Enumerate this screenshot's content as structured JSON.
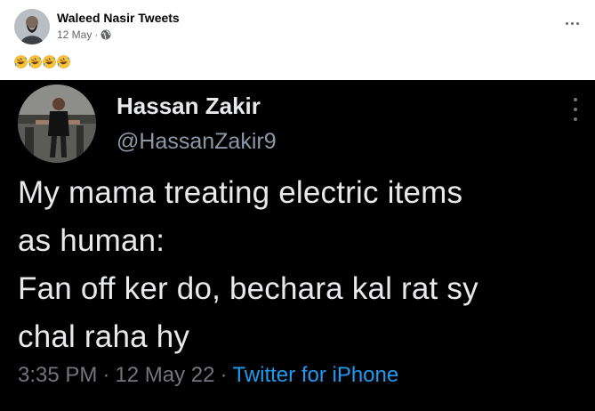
{
  "facebook_post": {
    "author": "Waleed Nasir Tweets",
    "date": "12 May",
    "meta_separator": "·",
    "audience_icon": "globe-icon",
    "more_icon": "more-horizontal-icon",
    "caption_emojis": [
      "rolling-on-floor-laughing-emoji",
      "rolling-on-floor-laughing-emoji",
      "rolling-on-floor-laughing-emoji",
      "rolling-on-floor-laughing-emoji"
    ]
  },
  "tweet": {
    "display_name": "Hassan Zakir",
    "handle": "@HassanZakir9",
    "more_icon": "more-vertical-icon",
    "text_lines": [
      "My mama treating electric items",
      "as human:",
      "Fan off ker do, bechara kal rat sy",
      "chal raha hy"
    ],
    "time": "3:35 PM",
    "date": "12 May 22",
    "separator": "·",
    "source": "Twitter for iPhone"
  },
  "colors": {
    "tweet_background": "#000000",
    "tweet_text": "#e7e9ea",
    "tweet_muted": "#71767b",
    "twitter_blue": "#1d9bf0",
    "fb_muted": "#65676b"
  }
}
